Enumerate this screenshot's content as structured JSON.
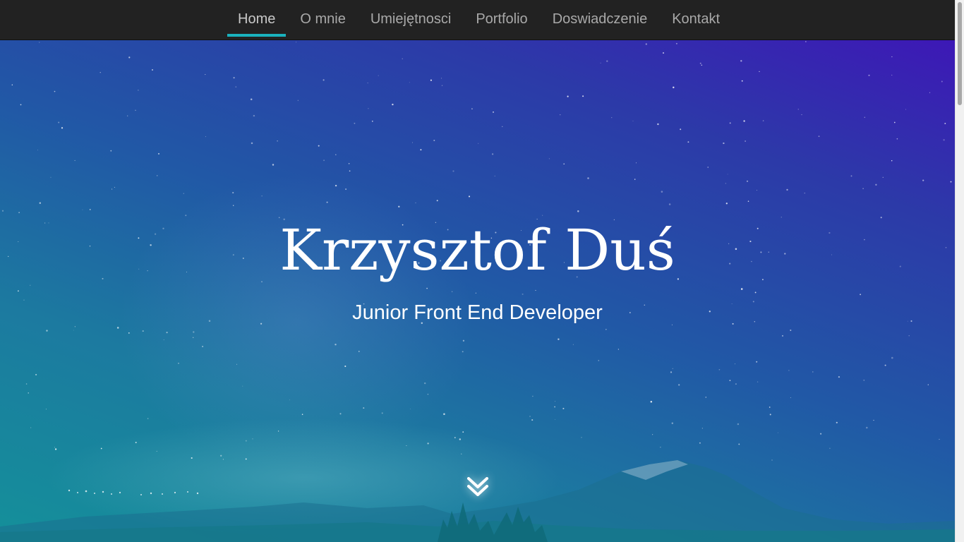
{
  "nav": {
    "items": [
      {
        "label": "Home",
        "active": true
      },
      {
        "label": "O mnie",
        "active": false
      },
      {
        "label": "Umiejętnosci",
        "active": false
      },
      {
        "label": "Portfolio",
        "active": false
      },
      {
        "label": "Doswiadczenie",
        "active": false
      },
      {
        "label": "Kontakt",
        "active": false
      }
    ],
    "accent_color": "#1ab2be"
  },
  "hero": {
    "title": "Krzysztof Duś",
    "subtitle": "Junior Front End Developer",
    "scroll_icon": "double-chevron-down-icon"
  }
}
